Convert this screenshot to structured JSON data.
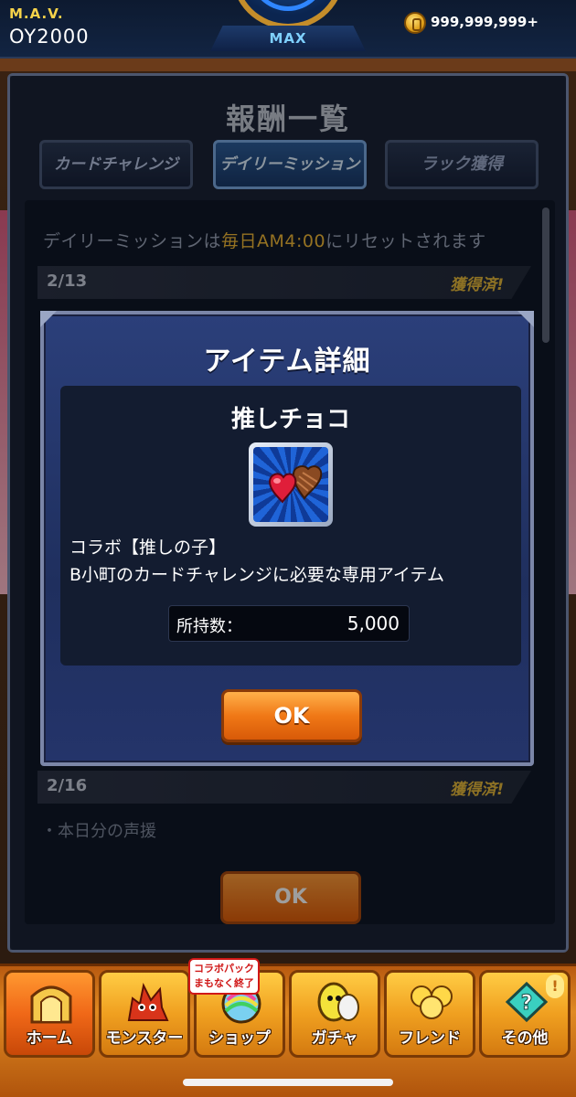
{
  "status": {
    "player_name": "M.A.V.",
    "player_id": "OY2000",
    "rank_label": "MAX",
    "coins": "999,999,999+"
  },
  "rewards_panel": {
    "title": "報酬一覧",
    "tabs": [
      {
        "label": "カードチャレンジ",
        "active": false
      },
      {
        "label": "デイリーミッション",
        "active": true
      },
      {
        "label": "ラック獲得",
        "active": false
      }
    ],
    "reset_note_prefix": "デイリーミッションは",
    "reset_note_highlight": "毎日AM4:00",
    "reset_note_suffix": "にリセットされます",
    "rows": [
      {
        "date": "2/13",
        "status": "獲得済!"
      },
      {
        "date": "2/16",
        "status": "獲得済!"
      }
    ],
    "bullet_item": "・本日分の声援",
    "ok_label": "OK"
  },
  "modal": {
    "title": "アイテム詳細",
    "item_name": "推しチョコ",
    "item_icon": "heart-chocolate-icon",
    "description_line1": "コラボ【推しの子】",
    "description_line2": "B小町のカードチャレンジに必要な専用アイテム",
    "quantity_label": "所持数：",
    "quantity_value": "5,000",
    "ok_label": "OK"
  },
  "bottom_nav": {
    "items": [
      {
        "label": "ホーム",
        "icon": "home-gate-icon"
      },
      {
        "label": "モンスター",
        "icon": "monster-icon"
      },
      {
        "label": "ショップ",
        "icon": "shop-orb-icon"
      },
      {
        "label": "ガチャ",
        "icon": "gacha-egg-icon"
      },
      {
        "label": "フレンド",
        "icon": "friend-balloons-icon"
      },
      {
        "label": "その他",
        "icon": "other-icon"
      }
    ],
    "collab_badge": "コラボパック\nまもなく終了",
    "notify_mark": "!"
  },
  "colors": {
    "accent_orange": "#f07816",
    "highlight_gold": "#f0b838",
    "panel_navy": "#1b2336"
  }
}
